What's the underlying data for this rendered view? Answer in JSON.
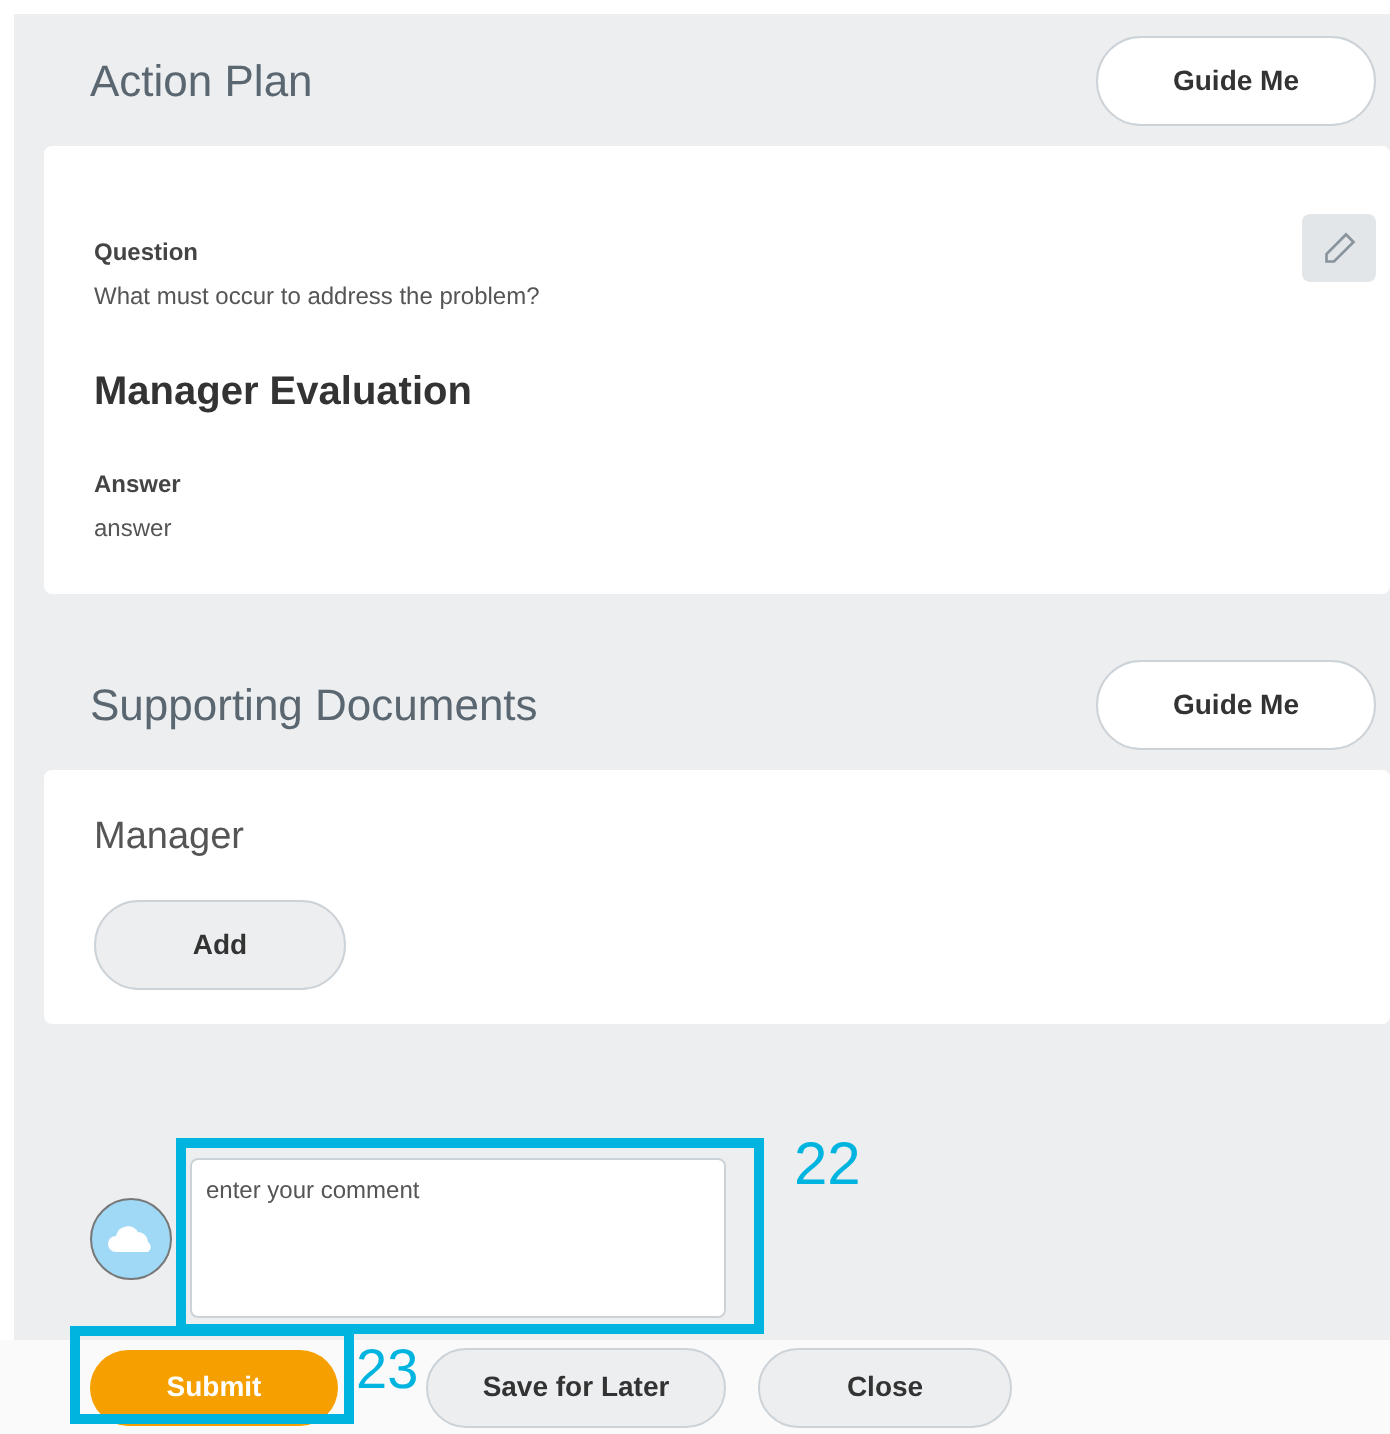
{
  "action_plan": {
    "title": "Action Plan",
    "guide_button": "Guide Me",
    "question_label": "Question",
    "question_text": "What must occur to address the problem?",
    "heading": "Manager Evaluation",
    "answer_label": "Answer",
    "answer_text": "answer"
  },
  "supporting_documents": {
    "title": "Supporting Documents",
    "guide_button": "Guide Me",
    "owner": "Manager",
    "add_button": "Add"
  },
  "comment": {
    "placeholder": "enter your comment",
    "annotation": "22"
  },
  "footer_buttons": [
    {
      "label": "Submit",
      "kind": "primary",
      "annotation": "23"
    },
    {
      "label": "Save for Later",
      "kind": "secondary"
    },
    {
      "label": "Close",
      "kind": "secondary"
    }
  ]
}
